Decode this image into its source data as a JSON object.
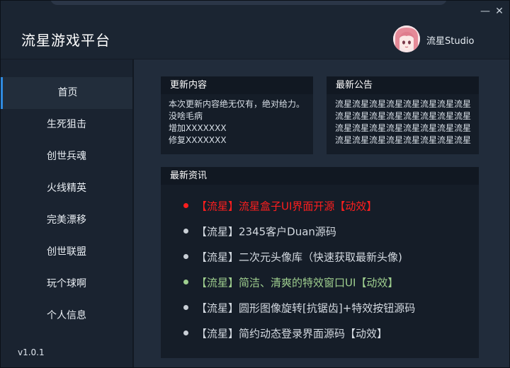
{
  "app": {
    "title": "流星游戏平台"
  },
  "user": {
    "name": "流星Studio"
  },
  "window_controls": {
    "minimize": "—",
    "close": "✕"
  },
  "sidebar": {
    "items": [
      {
        "label": "首页",
        "active": true
      },
      {
        "label": "生死狙击",
        "active": false
      },
      {
        "label": "创世兵魂",
        "active": false
      },
      {
        "label": "火线精英",
        "active": false
      },
      {
        "label": "完美漂移",
        "active": false
      },
      {
        "label": "创世联盟",
        "active": false
      },
      {
        "label": "玩个球啊",
        "active": false
      },
      {
        "label": "个人信息",
        "active": false
      }
    ],
    "version": "v1.0.1"
  },
  "update_panel": {
    "title": "更新内容",
    "lines": [
      "本次更新内容绝无仅有，绝对给力。",
      "没啥毛病",
      "增加XXXXXXX",
      "修复XXXXXXX"
    ]
  },
  "notice_panel": {
    "title": "最新公告",
    "lines": [
      "流星流星流星流星流星流星流星流星",
      "流星流星流星流星流星流星流星流星",
      "流星流星流星流星流星流星流星流星",
      "流星流星流星流星流星流星流星流星"
    ]
  },
  "news_panel": {
    "title": "最新资讯",
    "items": [
      {
        "text": "【流星】流星盒子UI界面开源【动效】",
        "color": "#ff1e1e",
        "dot": "#ff1e1e"
      },
      {
        "text": "【流星】2345客户Duan源码",
        "color": "#d3d9e0",
        "dot": "#c9cfd6"
      },
      {
        "text": "【流星】二次元头像库（快速获取最新头像)",
        "color": "#d3d9e0",
        "dot": "#c9cfd6"
      },
      {
        "text": "【流星】简洁、清爽的特效窗口UI【动效】",
        "color": "#9fcf8f",
        "dot": "#9fcf8f"
      },
      {
        "text": "【流星】圆形图像旋转[抗锯齿]+特效按钮源码",
        "color": "#d3d9e0",
        "dot": "#c9cfd6"
      },
      {
        "text": "【流星】简约动态登录界面源码【动效】",
        "color": "#d3d9e0",
        "dot": "#c9cfd6"
      }
    ]
  }
}
